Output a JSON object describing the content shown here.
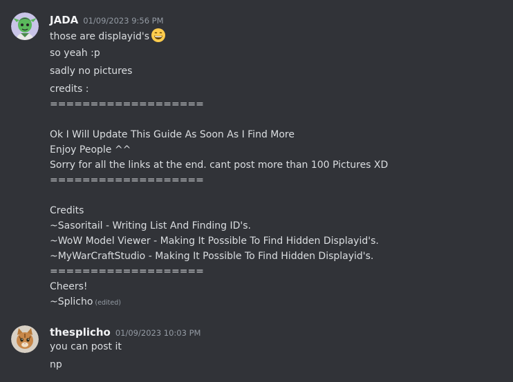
{
  "messages": [
    {
      "author": "JADA",
      "timestamp": "01/09/2023 9:56 PM",
      "avatar": "green-character-avatar",
      "lines": [
        "those are displayid's",
        "so yeah :p",
        "sadly no pictures",
        "credits :",
        "===================",
        "Ok I Will Update This Guide As Soon As I Find More",
        "Enjoy People ^^",
        "Sorry for all the links at the end. cant post more than 100 Pictures XD",
        "===================",
        "Credits",
        "~Sasoritail - Writing List And Finding ID's.",
        "~WoW Model Viewer - Making It Possible To Find Hidden Displayid's.",
        "~MyWarCraftStudio - Making It Possible To Find Hidden Displayid's.",
        "===================",
        "Cheers!",
        "~Splicho"
      ],
      "emoji": "grinning-face-emoji",
      "edited_label": "(edited)"
    },
    {
      "author": "thesplicho",
      "timestamp": "01/09/2023 10:03 PM",
      "avatar": "cat-avatar",
      "lines": [
        "you can post it",
        "np"
      ]
    }
  ],
  "colors": {
    "background": "#313338",
    "text": "#dbdee1",
    "username": "#f2f3f5",
    "muted": "#949ba4"
  }
}
